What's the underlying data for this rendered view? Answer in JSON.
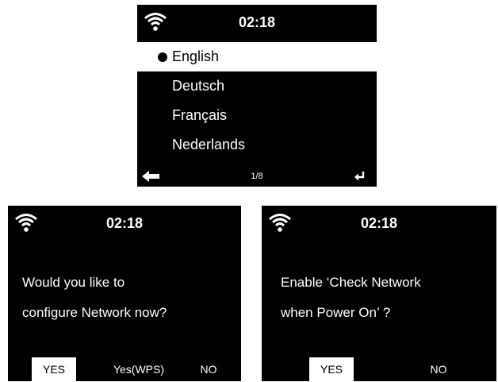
{
  "top_screen": {
    "clock": "02:18",
    "languages": [
      {
        "label": "English",
        "selected": true
      },
      {
        "label": "Deutsch",
        "selected": false
      },
      {
        "label": "Français",
        "selected": false
      },
      {
        "label": "Nederlands",
        "selected": false
      }
    ],
    "page_indicator": "1/8",
    "icons": {
      "status": "wifi-icon",
      "back": "back-arrow-icon",
      "enter": "enter-icon"
    }
  },
  "network_dialog": {
    "clock": "02:18",
    "message_lines": [
      "Would you like to",
      "configure Network now?"
    ],
    "buttons": [
      {
        "label": "YES",
        "selected": true
      },
      {
        "label": "Yes(WPS)",
        "selected": false
      },
      {
        "label": "NO",
        "selected": false
      }
    ]
  },
  "check_network_dialog": {
    "clock": "02:18",
    "message_lines": [
      "Enable ‘Check Network",
      "when Power On’ ?"
    ],
    "buttons": [
      {
        "label": "YES",
        "selected": true
      },
      {
        "label": "NO",
        "selected": false
      }
    ]
  },
  "colors": {
    "screen_bg": "#000000",
    "text": "#ffffff",
    "highlight_bg": "#ffffff",
    "highlight_text": "#000000"
  }
}
